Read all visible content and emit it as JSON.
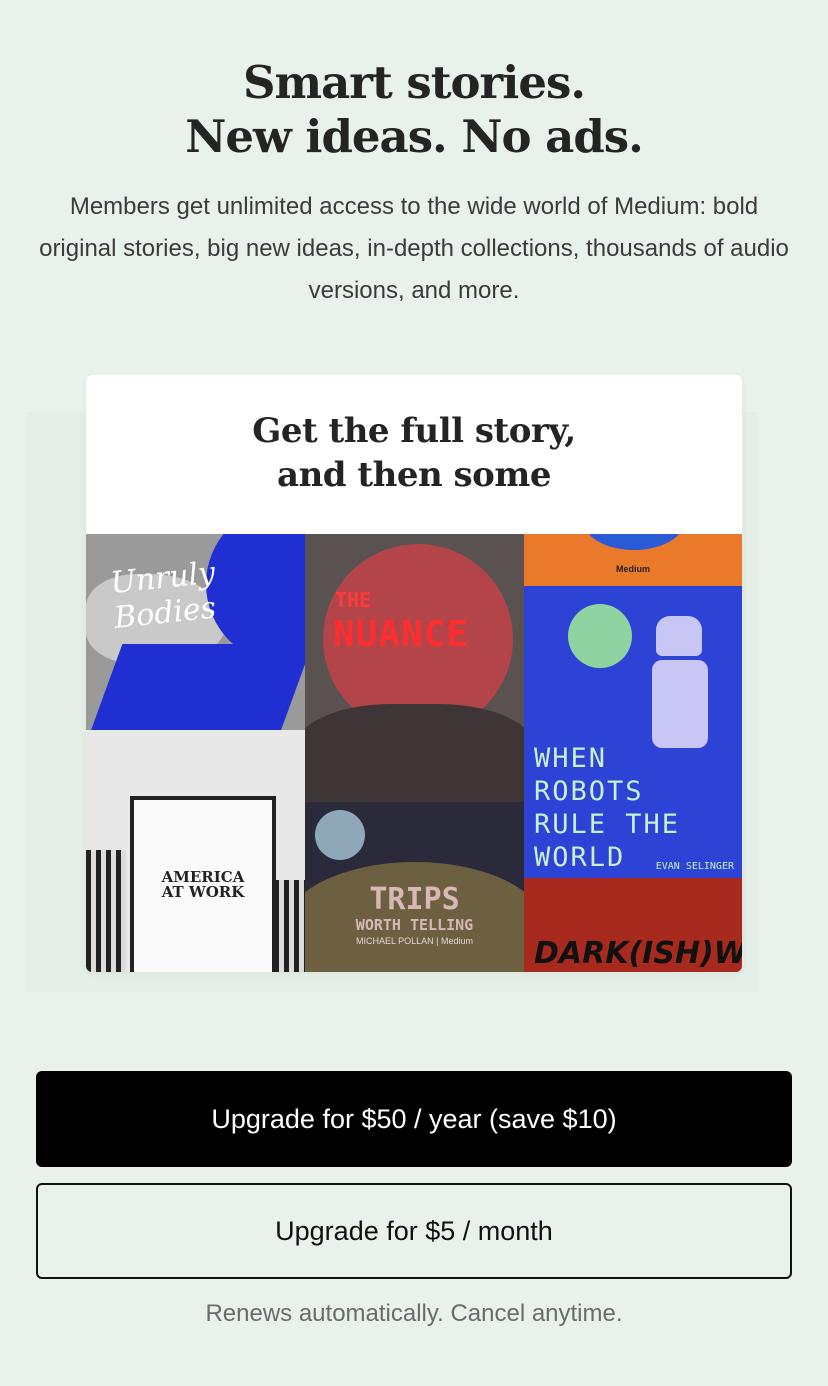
{
  "headline": {
    "line1": "Smart stories.",
    "line2": "New ideas. No ads."
  },
  "subcopy": "Members get unlimited access to the wide world of Medium: bold original stories, big new ideas, in-depth collections, thousands of audio versions, and more.",
  "card": {
    "title_line1": "Get the full story,",
    "title_line2": "and then some",
    "collage": {
      "unruly_bodies": "Unruly Bodies",
      "nuance_small": "THE",
      "nuance": "NUANCE",
      "medium_label": "Medium",
      "robots": [
        "WHEN",
        "ROBOTS",
        "RULE THE",
        "WORLD"
      ],
      "robots_author": "EVAN SELINGER",
      "america_line1": "AMERICA",
      "america_line2": "AT WORK",
      "trips": "TRIPS",
      "trips_sub": "WORTH TELLING",
      "trips_credit": "MICHAEL POLLAN | Medium",
      "dark_web": "DARK(ISH)WEB"
    }
  },
  "buttons": {
    "annual": "Upgrade for $50 / year (save $10)",
    "monthly": "Upgrade for $5 / month"
  },
  "renew_note": "Renews automatically. Cancel anytime.",
  "colors": {
    "background": "#e8f1ea",
    "primary_button": "#000000",
    "text": "#242424"
  }
}
